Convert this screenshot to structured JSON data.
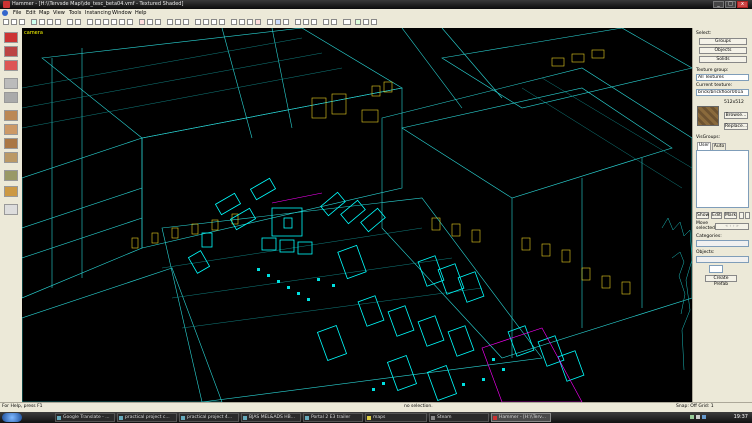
{
  "window": {
    "title": "Hammer - [H:\\\\Tervsde Map\\\\de_tesc_beta04.vmf - Textured Shaded]",
    "min": "_",
    "max": "□",
    "close": "x"
  },
  "menu": [
    "File",
    "Edit",
    "Map",
    "View",
    "Tools",
    "Instancing",
    "Window",
    "Help"
  ],
  "viewport": {
    "label": "camera"
  },
  "right_panel": {
    "select_label": "Select:",
    "groups_button": "Groups",
    "objects_button": "Objects",
    "solids_button": "Solids",
    "texture_group_label": "Texture group:",
    "texture_group_value": "All Textures",
    "current_texture_label": "Current texture:",
    "current_texture_value": "brick/brickfloor001a",
    "texture_size": "512x512",
    "browse_button": "Browse...",
    "replace_button": "Replace...",
    "visgroups_label": "VisGroups:",
    "tab_user": "User",
    "tab_auto": "Auto",
    "show_button": "Show",
    "edit_button": "Edit",
    "mark_button": "Mark",
    "move_selected_label": "Move selected:",
    "categories_label": "Categories:",
    "objects_label": "Objects:",
    "create_prefab_button": "Create Prefab"
  },
  "status": {
    "help": "For Help, press F1",
    "selection": "no selection.",
    "snap": "Snap: Off Grid: 1"
  },
  "taskbar": {
    "tasks": [
      "Google Translate - ...",
      "practical project c...",
      "practical project 4...",
      "BJAS MEL&ADS HB...",
      "Portal 2 E3 trailer",
      "maps",
      "Steam",
      "Hammer - [H:\\\\Terv..."
    ],
    "clock": "19:37"
  }
}
